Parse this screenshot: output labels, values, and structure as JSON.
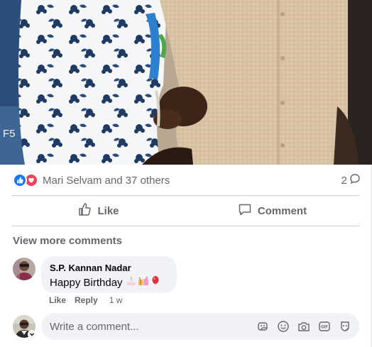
{
  "photo": {
    "tag": "F5"
  },
  "reactions": {
    "icons": [
      "like-icon",
      "love-icon"
    ],
    "summary": "Mari Selvam and 37 others",
    "comment_count": "2"
  },
  "actions": {
    "like_label": "Like",
    "comment_label": "Comment"
  },
  "comments_section": {
    "view_more_label": "View more comments",
    "comments": [
      {
        "author": "S.P. Kannan Nadar",
        "text": "Happy Birthday",
        "emojis": [
          "cake-emoji",
          "gift-emoji",
          "balloon-emoji"
        ],
        "like_label": "Like",
        "reply_label": "Reply",
        "time": "1 w"
      }
    ]
  },
  "composer": {
    "placeholder": "Write a comment...",
    "icons": [
      "sticker-icon",
      "emoji-icon",
      "camera-icon",
      "gif-icon",
      "avatar-sticker-icon"
    ]
  },
  "colors": {
    "brand_blue": "#1877f2",
    "love_red": "#f33e58",
    "secondary_text": "#65676b",
    "bubble_bg": "#f0f2f5"
  }
}
